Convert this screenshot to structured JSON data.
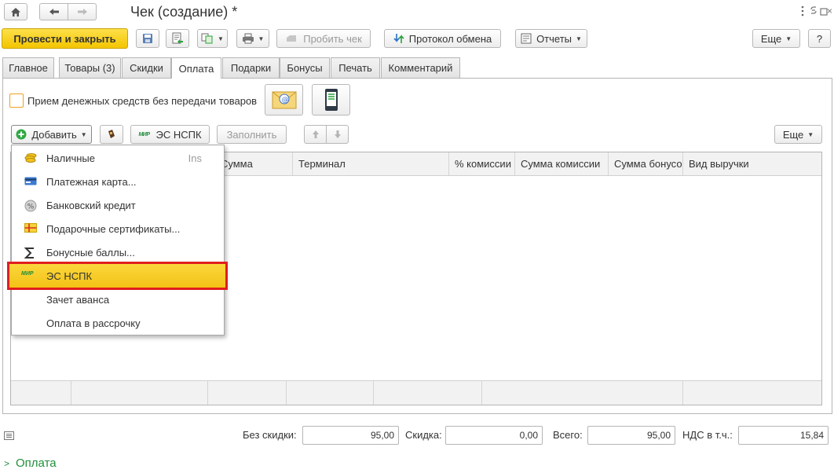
{
  "window": {
    "title": "Чек (создание) *",
    "menu_icon": "more-vert-icon",
    "link_icon": "link-icon",
    "maximize_icon": "maximize-icon",
    "close_icon": "close-icon"
  },
  "toolbar": {
    "post_close_label": "Провести и закрыть",
    "print_check_label": "Пробить чек",
    "exchange_log_label": "Протокол обмена",
    "reports_label": "Отчеты",
    "more_label": "Еще",
    "help_label": "?"
  },
  "tabs": [
    {
      "label": "Главное"
    },
    {
      "label": "Товары (3)"
    },
    {
      "label": "Скидки"
    },
    {
      "label": "Оплата"
    },
    {
      "label": "Подарки"
    },
    {
      "label": "Бонусы"
    },
    {
      "label": "Печать"
    },
    {
      "label": "Комментарий"
    }
  ],
  "active_tab": "Оплата",
  "payment": {
    "checkbox_label": "Прием денежных средств без передачи товаров",
    "checkbox_checked": false,
    "add_label": "Добавить",
    "nspk_label": "ЭС НСПК",
    "fill_label": "Заполнить",
    "more_label": "Еще",
    "nspk_logo_text": "МИР"
  },
  "grid": {
    "columns": [
      "Сумма",
      "Терминал",
      "% комиссии",
      "Сумма комиссии",
      "Сумма бонусо",
      "Вид выручки"
    ]
  },
  "add_menu": {
    "items": [
      {
        "label": "Наличные",
        "shortcut": "Ins",
        "icon": "cash-icon"
      },
      {
        "label": "Платежная карта...",
        "shortcut": "",
        "icon": "card-icon"
      },
      {
        "label": "Банковский кредит",
        "shortcut": "",
        "icon": "percent-icon"
      },
      {
        "label": "Подарочные сертификаты...",
        "shortcut": "",
        "icon": "gift-certificate-icon"
      },
      {
        "label": "Бонусные баллы...",
        "shortcut": "",
        "icon": "sigma-icon"
      },
      {
        "label": "ЭС НСПК",
        "shortcut": "",
        "icon": "mir-icon",
        "logo_text": "МИР"
      },
      {
        "label": "Зачет аванса",
        "shortcut": "",
        "icon": ""
      },
      {
        "label": "Оплата в рассрочку",
        "shortcut": "",
        "icon": ""
      }
    ],
    "highlighted_index": 5
  },
  "totals": {
    "no_discount_label": "Без скидки:",
    "no_discount_value": "95,00",
    "discount_label": "Скидка:",
    "discount_value": "0,00",
    "total_label": "Всего:",
    "total_value": "95,00",
    "vat_label": "НДС в т.ч.:",
    "vat_value": "15,84"
  },
  "bottom_section": {
    "label": "Оплата"
  },
  "colors": {
    "primary_button": "#f9d31c",
    "highlight": "#f7c921",
    "highlight_border": "#e01e1e",
    "section_link": "#1f8f3a"
  }
}
